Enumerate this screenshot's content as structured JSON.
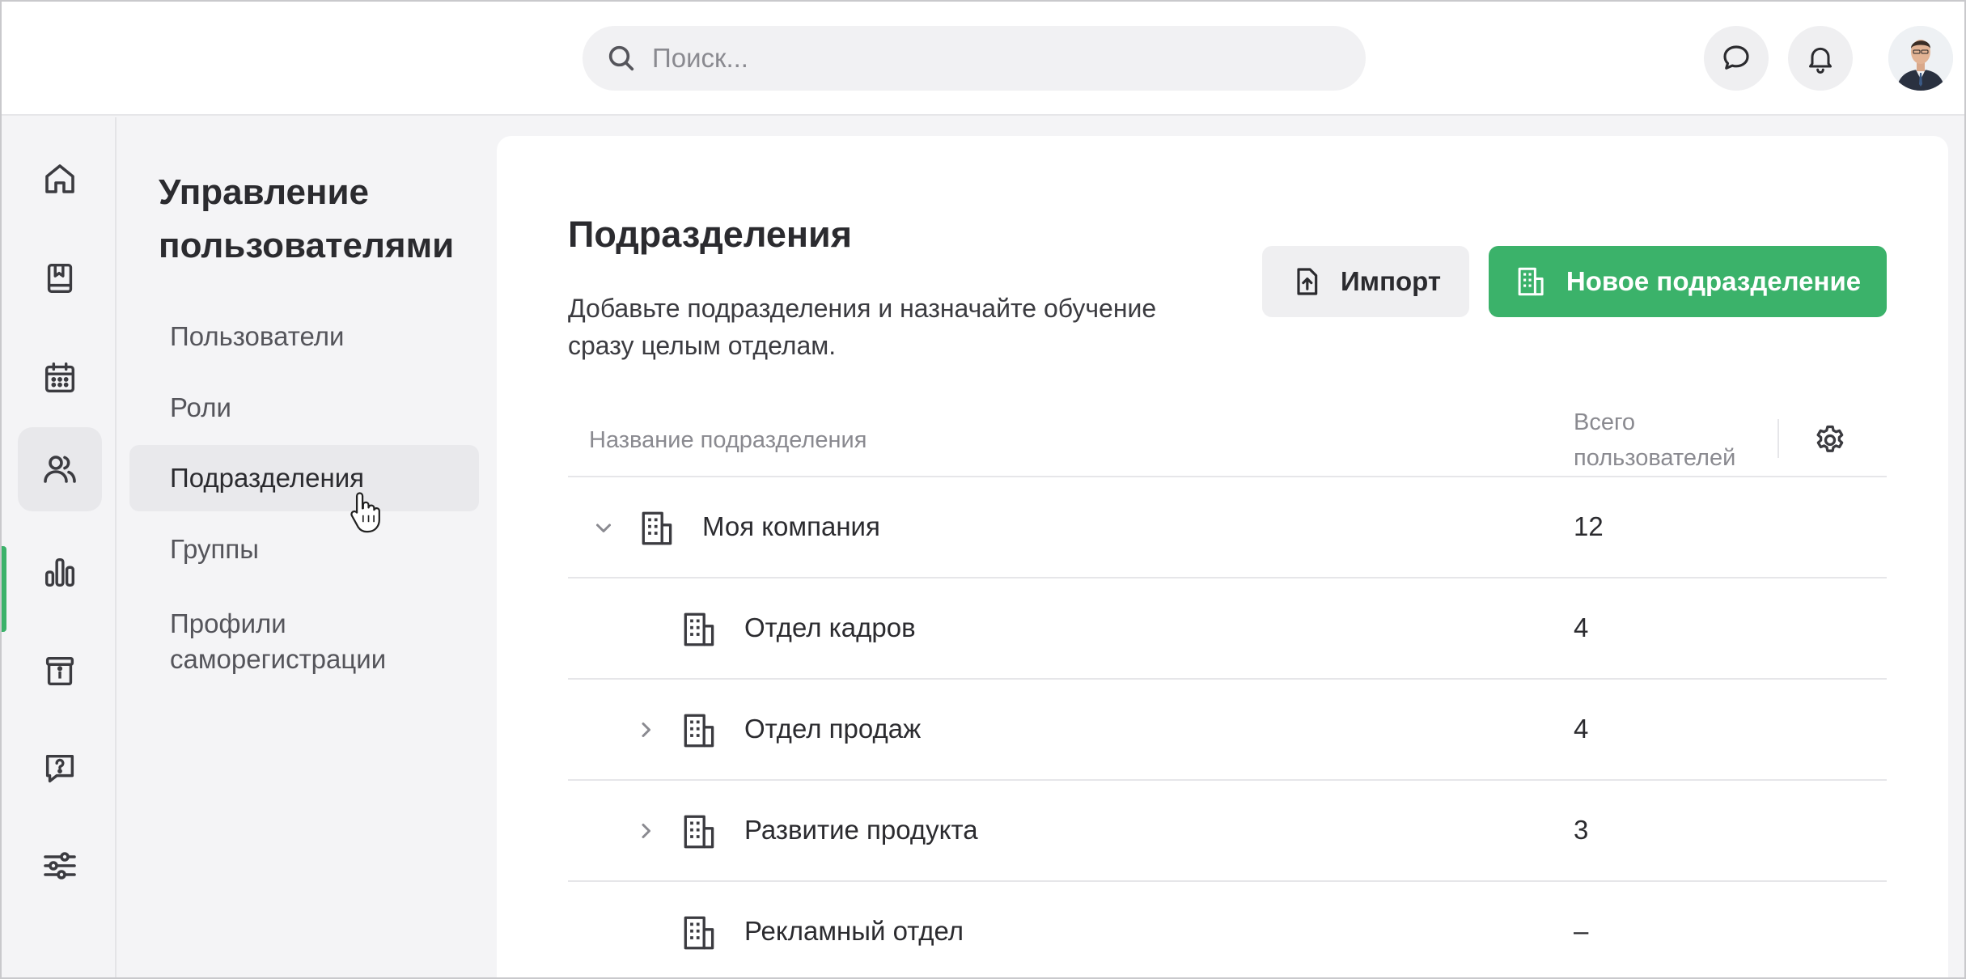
{
  "header": {
    "search_placeholder": "Поиск...",
    "icons": [
      "search-icon",
      "chat-icon",
      "bell-icon",
      "avatar"
    ]
  },
  "rail": {
    "items": [
      {
        "name": "home-icon",
        "active": false
      },
      {
        "name": "book-icon",
        "active": false
      },
      {
        "name": "calendar-icon",
        "active": false
      },
      {
        "name": "users-icon",
        "active": true
      },
      {
        "name": "chart-icon",
        "active": false
      },
      {
        "name": "info-box-icon",
        "active": false
      },
      {
        "name": "help-chat-icon",
        "active": false
      },
      {
        "name": "sliders-icon",
        "active": false
      }
    ],
    "accent_color": "#3bb26a"
  },
  "section": {
    "title": "Управление пользователями",
    "items": [
      {
        "label": "Пользователи",
        "active": false
      },
      {
        "label": "Роли",
        "active": false
      },
      {
        "label": "Подразделения",
        "active": true
      },
      {
        "label": "Группы",
        "active": false
      },
      {
        "label": "Профили саморегистрации",
        "active": false
      }
    ]
  },
  "main": {
    "title": "Подразделения",
    "description": "Добавьте подразделения и назначайте обучение сразу целым отделам.",
    "import_label": "Импорт",
    "new_label": "Новое подразделение",
    "primary_color": "#3bb26a"
  },
  "table": {
    "col_name": "Название подразделения",
    "col_count": "Всего пользователей",
    "rows": [
      {
        "name": "Моя компания",
        "count": "12",
        "level": 0,
        "expander": "expanded"
      },
      {
        "name": "Отдел кадров",
        "count": "4",
        "level": 1,
        "expander": "none"
      },
      {
        "name": "Отдел продаж",
        "count": "4",
        "level": 1,
        "expander": "collapsed"
      },
      {
        "name": "Развитие продукта",
        "count": "3",
        "level": 1,
        "expander": "collapsed"
      },
      {
        "name": "Рекламный отдел",
        "count": "–",
        "level": 1,
        "expander": "none"
      }
    ]
  }
}
